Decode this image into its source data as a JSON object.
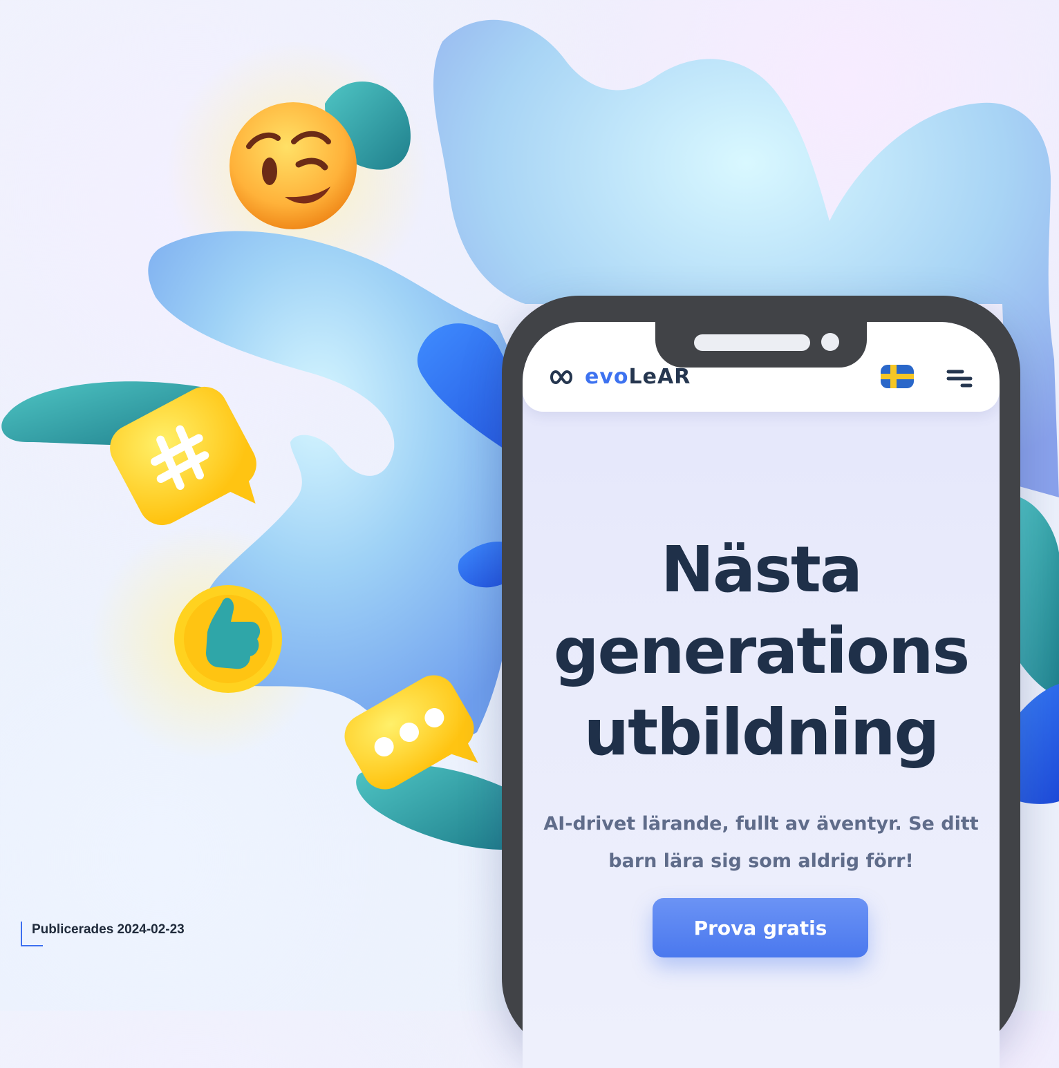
{
  "app": {
    "logo_prefix": "evo",
    "logo_suffix": "LeAR",
    "flag_icon": "sweden-flag-icon",
    "menu_icon": "menu-icon"
  },
  "hero": {
    "title_line_1": "Nästa",
    "title_line_2": "generations",
    "title_line_3": "utbildning",
    "subtitle": "AI-drivet lärande, fullt av äventyr. Se ditt barn lära sig som aldrig förr!",
    "cta_label": "Prova gratis"
  },
  "article": {
    "published": "Publicerades 2024-02-23"
  },
  "decorations": {
    "icons": [
      "wink-emoji-icon",
      "hashtag-bubble-icon",
      "thumbs-up-icon",
      "chat-bubble-icon"
    ]
  },
  "colors": {
    "accent": "#3d72f0",
    "heading": "#1f3049",
    "subtitle": "#5f6c8a",
    "emoji_yellow": "#ffd21f",
    "blob_blue": "#8cc4f2",
    "blob_teal": "#2e9ea4"
  }
}
